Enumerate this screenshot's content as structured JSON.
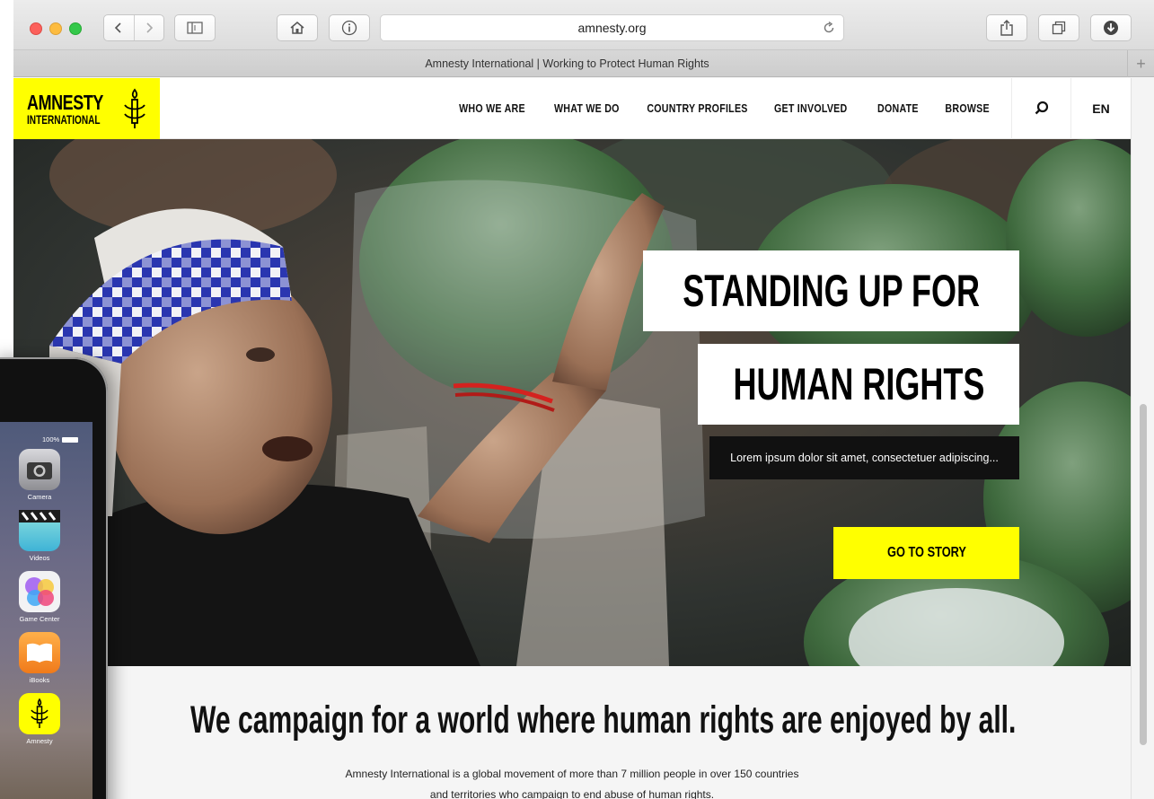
{
  "browser": {
    "url": "amnesty.org",
    "tab_title": "Amnesty International | Working to Protect Human Rights",
    "new_tab_label": "+"
  },
  "site": {
    "logo": {
      "line1": "AMNESTY",
      "line2": "INTERNATIONAL"
    },
    "nav": [
      "WHO WE ARE",
      "WHAT WE DO",
      "COUNTRY PROFILES",
      "GET INVOLVED",
      "DONATE",
      "BROWSE"
    ],
    "language": "EN",
    "hero": {
      "headline_line1": "STANDING UP FOR",
      "headline_line2": "HUMAN RIGHTS",
      "subtitle": "Lorem ipsum dolor sit amet, consectetuer adipiscing...",
      "cta": "GO TO STORY"
    },
    "mission": {
      "title": "We campaign for a world where human rights are enjoyed by all.",
      "body_line1": "Amnesty International is a global movement of more than 7 million people in over 150 countries",
      "body_line2": "and territories who campaign to end abuse of human rights."
    }
  },
  "phone": {
    "battery": "100%",
    "apps": [
      {
        "label": "Camera",
        "icon": "camera-icon"
      },
      {
        "label": "Videos",
        "icon": "videos-icon"
      },
      {
        "label": "Game Center",
        "icon": "game-center-icon"
      },
      {
        "label": "iBooks",
        "icon": "ibooks-icon"
      },
      {
        "label": "Amnesty",
        "icon": "amnesty-candle-icon"
      }
    ],
    "partial_labels": [
      "s",
      "s",
      "re",
      "s"
    ]
  },
  "colors": {
    "brand_yellow": "#ffff00",
    "text_black": "#000000",
    "subtitle_bg": "#111111"
  }
}
